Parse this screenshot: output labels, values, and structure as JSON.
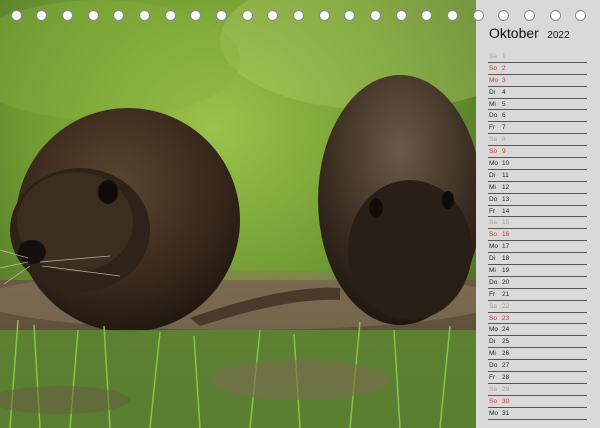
{
  "calendar": {
    "month": "Oktober",
    "year": "2022",
    "days": [
      {
        "wd": "Sa",
        "d": "1",
        "kind": "sat"
      },
      {
        "wd": "So",
        "d": "2",
        "kind": "sun"
      },
      {
        "wd": "Mo",
        "d": "3",
        "kind": "hol"
      },
      {
        "wd": "Di",
        "d": "4",
        "kind": "week"
      },
      {
        "wd": "Mi",
        "d": "5",
        "kind": "week"
      },
      {
        "wd": "Do",
        "d": "6",
        "kind": "week"
      },
      {
        "wd": "Fr",
        "d": "7",
        "kind": "week"
      },
      {
        "wd": "Sa",
        "d": "8",
        "kind": "sat"
      },
      {
        "wd": "So",
        "d": "9",
        "kind": "sun"
      },
      {
        "wd": "Mo",
        "d": "10",
        "kind": "week"
      },
      {
        "wd": "Di",
        "d": "11",
        "kind": "week"
      },
      {
        "wd": "Mi",
        "d": "12",
        "kind": "week"
      },
      {
        "wd": "Do",
        "d": "13",
        "kind": "week"
      },
      {
        "wd": "Fr",
        "d": "14",
        "kind": "week"
      },
      {
        "wd": "Sa",
        "d": "15",
        "kind": "sat"
      },
      {
        "wd": "So",
        "d": "16",
        "kind": "sun"
      },
      {
        "wd": "Mo",
        "d": "17",
        "kind": "week"
      },
      {
        "wd": "Di",
        "d": "18",
        "kind": "week"
      },
      {
        "wd": "Mi",
        "d": "19",
        "kind": "week"
      },
      {
        "wd": "Do",
        "d": "20",
        "kind": "week"
      },
      {
        "wd": "Fr",
        "d": "21",
        "kind": "week"
      },
      {
        "wd": "Sa",
        "d": "22",
        "kind": "sat"
      },
      {
        "wd": "So",
        "d": "23",
        "kind": "sun"
      },
      {
        "wd": "Mo",
        "d": "24",
        "kind": "week"
      },
      {
        "wd": "Di",
        "d": "25",
        "kind": "week"
      },
      {
        "wd": "Mi",
        "d": "26",
        "kind": "week"
      },
      {
        "wd": "Do",
        "d": "27",
        "kind": "week"
      },
      {
        "wd": "Fr",
        "d": "28",
        "kind": "week"
      },
      {
        "wd": "Sa",
        "d": "29",
        "kind": "sat"
      },
      {
        "wd": "So",
        "d": "30",
        "kind": "sun"
      },
      {
        "wd": "Mo",
        "d": "31",
        "kind": "week"
      }
    ]
  },
  "colors": {
    "sunday": "#d0302a",
    "saturday": "#a0a0a0",
    "panel": "#d9d9d9"
  }
}
